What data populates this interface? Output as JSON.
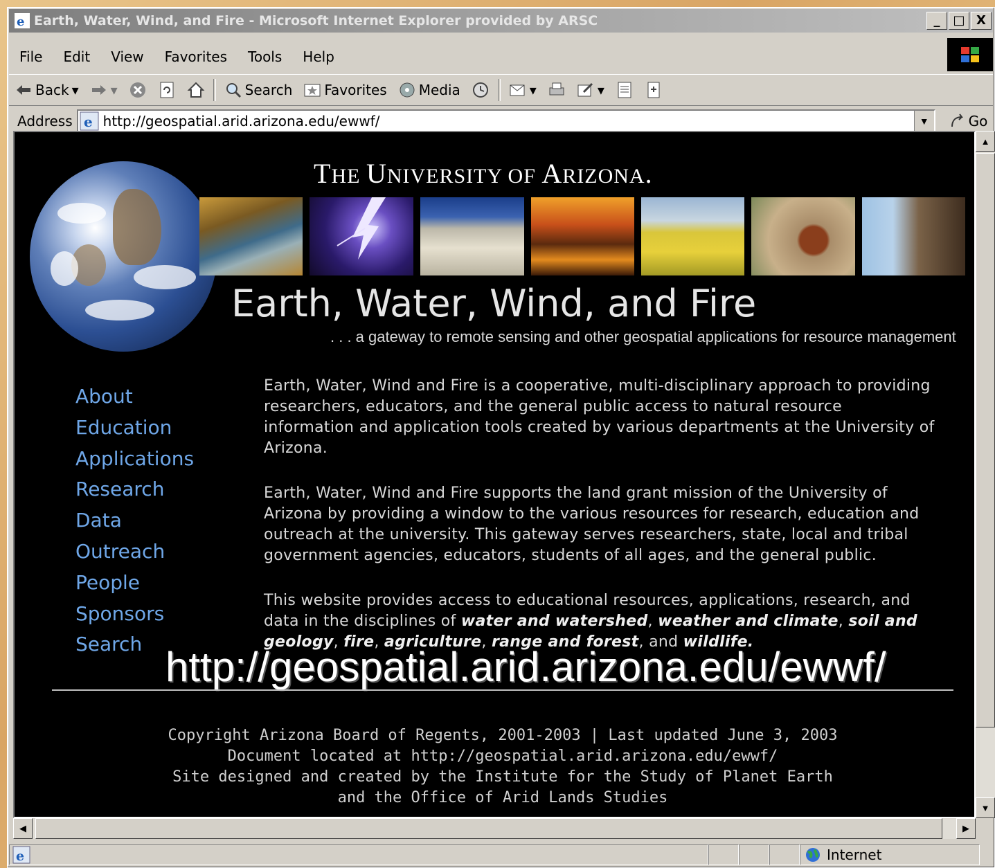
{
  "window": {
    "title": "Earth, Water, Wind, and Fire - Microsoft Internet Explorer provided by ARSC",
    "buttons": [
      "_",
      "□",
      "X"
    ]
  },
  "menu": [
    "File",
    "Edit",
    "View",
    "Favorites",
    "Tools",
    "Help"
  ],
  "toolbar": {
    "back": "Back",
    "search": "Search",
    "favorites": "Favorites",
    "media": "Media"
  },
  "address": {
    "label": "Address",
    "url": "http://geospatial.arid.arizona.edu/ewwf/",
    "go": "Go"
  },
  "page": {
    "university": {
      "t1": "T",
      "t2": "HE ",
      "u1": "U",
      "u2": "NIVERSITY OF ",
      "a1": "A",
      "a2": "RIZONA",
      "dot": "."
    },
    "headline": "Earth, Water, Wind, and Fire",
    "tagline": ". . . a gateway to remote sensing and other geospatial applications for resource management",
    "nav": [
      "About",
      "Education",
      "Applications",
      "Research",
      "Data",
      "Outreach",
      "People",
      "Sponsors",
      "Search"
    ],
    "p1": "Earth, Water, Wind and Fire is a cooperative, multi-disciplinary approach to providing researchers, educators, and the general public access to natural resource information and application tools created by various departments at the University of Arizona.",
    "p2": "Earth, Water, Wind and Fire supports the land grant mission of the University of Arizona by providing a window to the various resources for research, education and outreach at the university. This gateway serves researchers, state, local and tribal government agencies, educators, students of all ages, and the general public.",
    "p3": {
      "intro": "This website provides access to educational resources, applications, research, and data in the disciplines of ",
      "d1": "water and watershed",
      "d2": "weather and climate",
      "d3": "soil and geology",
      "d4": "fire",
      "d5": "agriculture",
      "d6": "range and forest",
      "and": "and",
      "d7": "wildlife.",
      "comma": ", "
    },
    "overlay_url": "http://geospatial.arid.arizona.edu/ewwf/",
    "footer": [
      "Copyright Arizona Board of Regents, 2001-2003 | Last updated June 3, 2003",
      "Document located at http://geospatial.arid.arizona.edu/ewwf/",
      "Site designed and created by the Institute for the Study of Planet Earth",
      "and the Office of Arid Lands Studies"
    ]
  },
  "status": {
    "zone": "Internet"
  },
  "colors": {
    "link": "#6fa7e8",
    "page_bg": "#000000",
    "chrome": "#d4d0c8"
  }
}
